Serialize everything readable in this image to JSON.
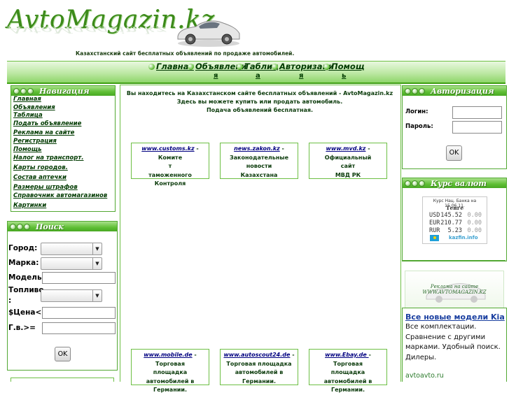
{
  "header": {
    "logo": "AvtoMagazin.kz",
    "tagline": "Казахстанский сайт бесплатных объявлений по продаже автомобилей."
  },
  "topnav": {
    "items": [
      "Главная",
      "Объявлени",
      "Таблиц",
      "Авторизаци",
      "Помощ"
    ],
    "overflow_letters": [
      "я",
      "я",
      "а",
      "я",
      "ь"
    ]
  },
  "navigation": {
    "title": "Навигация",
    "links": [
      "Главная",
      "Объявления",
      "Таблица",
      "Подать объявление",
      "Реклама на сайте",
      "Регистрация",
      "Помощь",
      "Налог на транспорт.",
      "Карты городов.",
      "Состав аптечки",
      "Размеры штрафов",
      "Справочник автомагазинов",
      "Картинки"
    ]
  },
  "search": {
    "title": "Поиск",
    "city_label": "Город:",
    "brand_label": "Марка:",
    "model_label": "Модель:",
    "fuel_label": "Топливо",
    "fuel_label_colon": ":",
    "price_label": "$Цена<=:",
    "year_label": "Г.в.>=",
    "ok": "OK"
  },
  "center": {
    "intro_line1": "Вы находитесь на Казахстанском сайте бесплатных объявлений - AvtoMagazin.kz",
    "intro_line2": "Здесь вы можете купить или продать автомобиль.",
    "intro_line3": "Подача объявлений бесплатная.",
    "cards_top": [
      {
        "link": "www.customs.kz",
        "lines": [
          " - Комите",
          "т",
          "таможенного",
          "Контроля"
        ]
      },
      {
        "link": "news.zakon.kz",
        "lines": [
          " -",
          "Законодательные",
          "новости",
          "Казахстана"
        ]
      },
      {
        "link": "www.mvd.kz",
        "lines": [
          " -",
          "Официальный",
          "сайт",
          "МВД РК"
        ]
      }
    ],
    "cards_bottom": [
      {
        "link": "www.mobile.de",
        "lines": [
          " - Торговая",
          "площадка",
          "автомобилей в",
          "Германии."
        ]
      },
      {
        "link": "www.autoscout24.de",
        "lines": [
          " -",
          "Торговая площадка",
          "автомобилей в",
          "Германии."
        ]
      },
      {
        "link": "www.Ebay.de ",
        "lines": [
          " - Торговая",
          "площадка",
          "автомобилей в",
          "Германии."
        ]
      }
    ]
  },
  "auth": {
    "title": "Авторизация",
    "login_label": "Логин:",
    "password_label": "Пароль:",
    "ok": "OK"
  },
  "rates": {
    "title": "Курс валют",
    "caption": "Курс Нац. Банка на 15.06.11.",
    "unit": "Тенге",
    "rows": [
      {
        "code": "USD",
        "value": "145.52",
        "change": "0.00"
      },
      {
        "code": "EUR",
        "value": "210.77",
        "change": "0.00"
      },
      {
        "code": "RUR",
        "value": "5.23",
        "change": "0.00"
      }
    ],
    "source": "kazfin.info"
  },
  "ad_banner": {
    "line1": "Реклама на сайте",
    "line2": "WWW.AVTOMAGAZIN.KZ"
  },
  "text_ad": {
    "title": "Все новые модели Kia",
    "body": "Все комплектации. Сравнение с другими марками. Удобный поиск. Дилеры.",
    "url": "avtoavto.ru"
  },
  "colors": {
    "accent_green": "#5fbf35",
    "link_dark_green": "#003a00",
    "link_blue": "#000080"
  }
}
